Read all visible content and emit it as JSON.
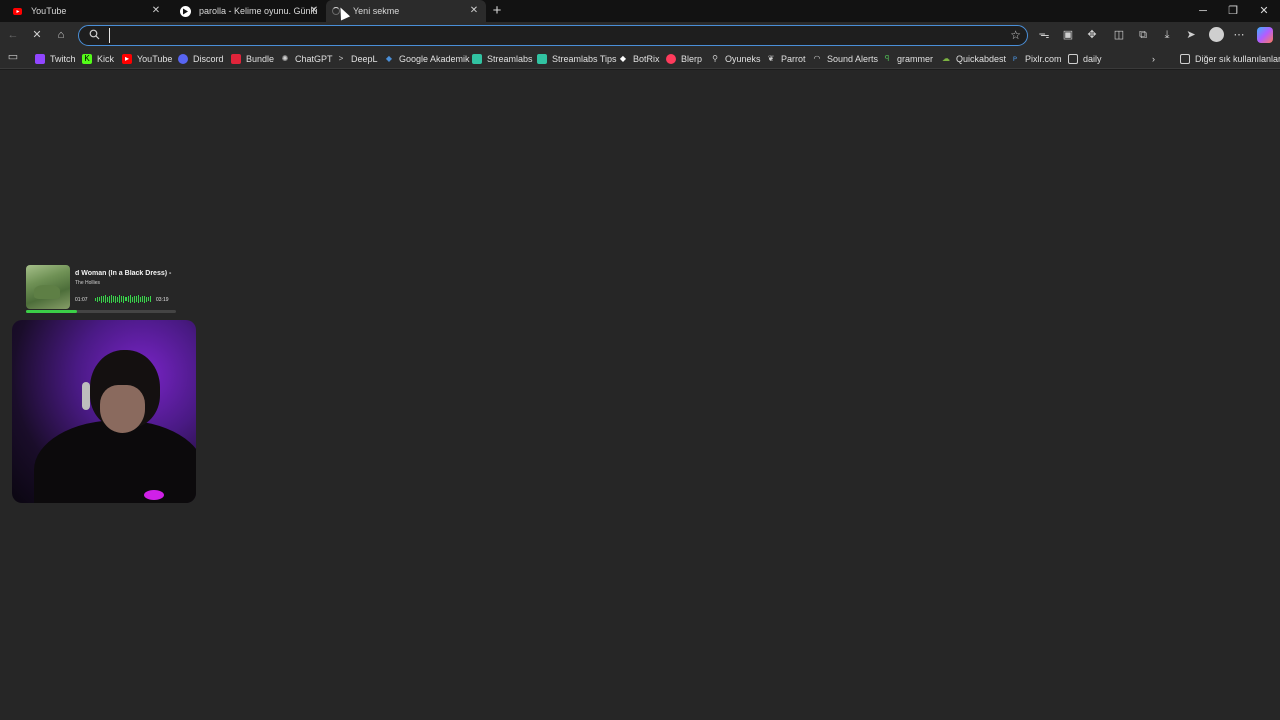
{
  "tabs": [
    {
      "title": "YouTube",
      "icon": "youtube-icon"
    },
    {
      "title": "parolla - Kelime oyunu. Günlük k",
      "icon": "parolla-icon"
    },
    {
      "title": "Yeni sekme",
      "icon": "loading-icon",
      "active": true
    }
  ],
  "toolbar": {
    "address_value": "",
    "address_placeholder": ""
  },
  "bookmarks": [
    {
      "label": "Twitch",
      "icon": "twitch-icon",
      "color": "#9146ff"
    },
    {
      "label": "Kick",
      "icon": "kick-icon",
      "color": "#53fc18"
    },
    {
      "label": "YouTube",
      "icon": "youtube-icon",
      "color": "#ff0000"
    },
    {
      "label": "Discord",
      "icon": "discord-icon",
      "color": "#5865f2"
    },
    {
      "label": "Bundle",
      "icon": "bundle-icon",
      "color": "#e0243a"
    },
    {
      "label": "ChatGPT",
      "icon": "chatgpt-icon",
      "color": "#cfcfcf"
    },
    {
      "label": "DeepL",
      "icon": "deepl-icon",
      "color": "#cfcfcf"
    },
    {
      "label": "Google Akademik",
      "icon": "scholar-icon",
      "color": "#4a8fd8"
    },
    {
      "label": "Streamlabs",
      "icon": "streamlabs-icon",
      "color": "#31c3a2"
    },
    {
      "label": "Streamlabs Tips",
      "icon": "streamlabs-icon",
      "color": "#31c3a2"
    },
    {
      "label": "BotRix",
      "icon": "botrix-icon",
      "color": "#ffffff"
    },
    {
      "label": "Blerp",
      "icon": "blerp-icon",
      "color": "#ff3b5c"
    },
    {
      "label": "Oyuneks",
      "icon": "oyuneks-icon",
      "color": "#cfcfcf"
    },
    {
      "label": "Parrot",
      "icon": "parrot-icon",
      "color": "#cfcfcf"
    },
    {
      "label": "Sound Alerts",
      "icon": "soundalerts-icon",
      "color": "#cfcfcf"
    },
    {
      "label": "grammer",
      "icon": "grammer-icon",
      "color": "#4caf50"
    },
    {
      "label": "Quickabdest",
      "icon": "quickabdest-icon",
      "color": "#7cb342"
    },
    {
      "label": "Pixlr.com",
      "icon": "pixlr-icon",
      "color": "#4a8fd8"
    },
    {
      "label": "daily",
      "icon": "folder-icon",
      "color": "#cfcfcf"
    }
  ],
  "other_bookmarks": "Diğer sık kullanılanlar",
  "player": {
    "song": "d Woman (In a Black Dress) -",
    "artist": "The Hollies",
    "elapsed": "01:07",
    "duration": "03:19",
    "progress_fraction": 0.34
  }
}
